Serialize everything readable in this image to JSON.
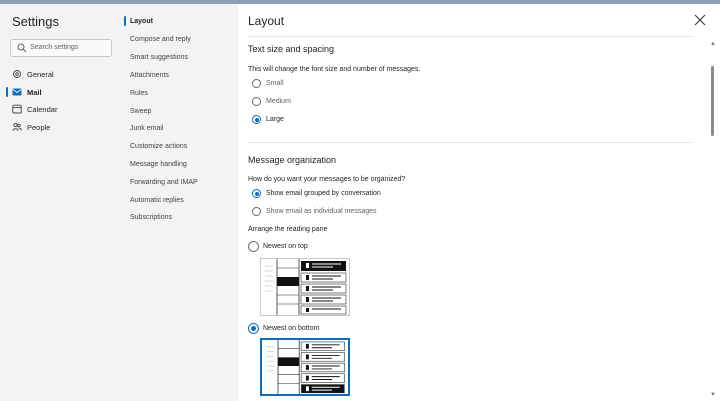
{
  "sidebar": {
    "title": "Settings",
    "search_placeholder": "Search settings",
    "items": [
      {
        "label": "General",
        "icon": "gear-icon"
      },
      {
        "label": "Mail",
        "icon": "mail-icon"
      },
      {
        "label": "Calendar",
        "icon": "calendar-icon"
      },
      {
        "label": "People",
        "icon": "people-icon"
      }
    ],
    "selected": "Mail"
  },
  "subnav": {
    "items": [
      "Layout",
      "Compose and reply",
      "Smart suggestions",
      "Attachments",
      "Rules",
      "Sweep",
      "Junk email",
      "Customize actions",
      "Message handling",
      "Forwarding and IMAP",
      "Automatic replies",
      "Subscriptions"
    ],
    "selected": "Layout"
  },
  "panel": {
    "title": "Layout",
    "text_size": {
      "title": "Text size and spacing",
      "description": "This will change the font size and number of messages.",
      "options": [
        "Small",
        "Medium",
        "Large"
      ],
      "selected": "Large"
    },
    "organization": {
      "title": "Message organization",
      "question": "How do you want your messages to be organized?",
      "options": [
        "Show email grouped by conversation",
        "Show email as individual messages"
      ],
      "selected": "Show email grouped by conversation",
      "reading_pane_label": "Arrange the reading pane",
      "reading_options": [
        "Newest on top",
        "Newest on bottom"
      ],
      "reading_selected": "Newest on bottom"
    }
  },
  "colors": {
    "accent": "#0f6cbd",
    "panel_bg": "#ffffff",
    "nav_bg": "#f3f3f3"
  }
}
